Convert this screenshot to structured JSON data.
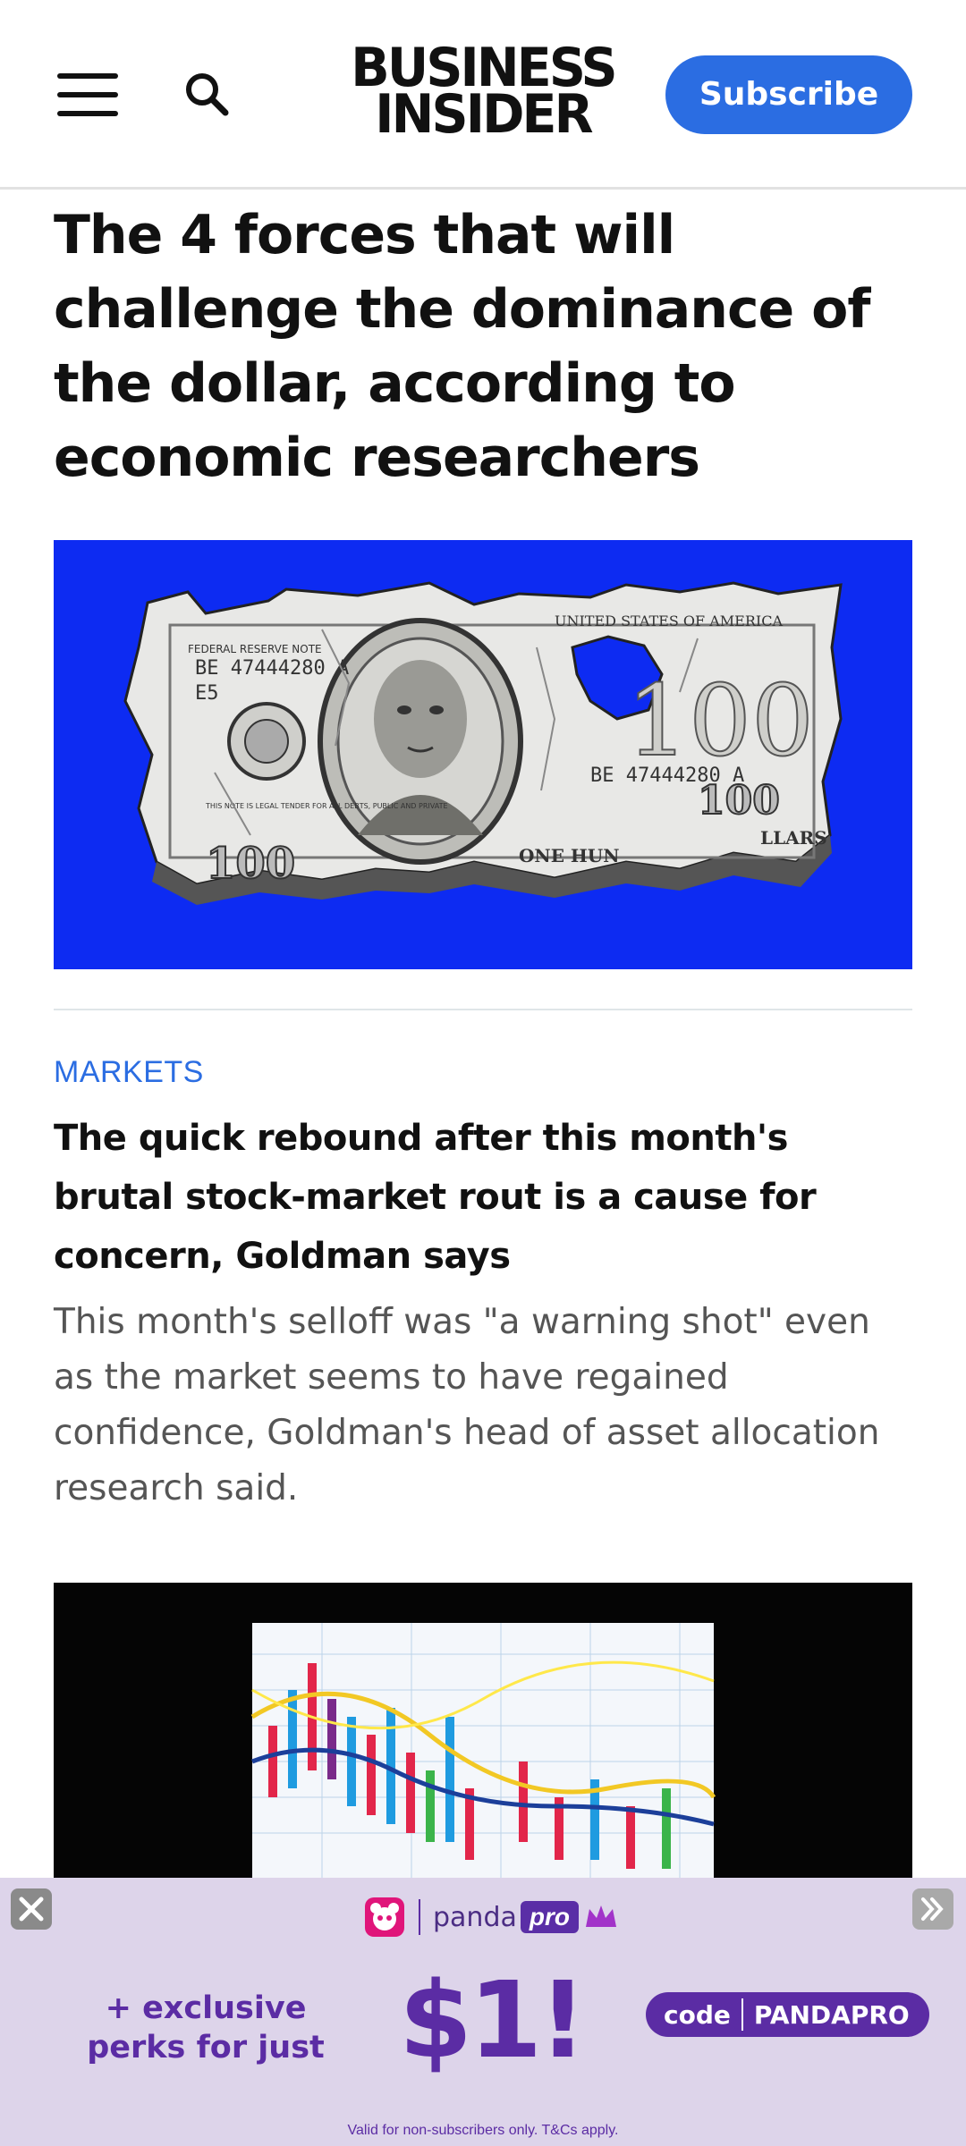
{
  "header": {
    "logo_line1": "BUSINESS",
    "logo_line2": "INSIDER",
    "subscribe_label": "Subscribe",
    "menu_icon": "hamburger-menu-icon",
    "search_icon": "search-icon"
  },
  "article": {
    "headline": "The 4 forces that will challenge the dominance of the dollar, according to economic researchers",
    "hero_alt": "torn hundred dollar bill on blue background",
    "hero_bill": {
      "serial": "BE 47444280 A",
      "serial_short": "E5",
      "denomination": "100",
      "word_100": "ONE HUN",
      "dollars_text": "LLARS",
      "federal": "FEDERAL RESERVE NOTE",
      "united_states": "UNITED STATES OF AMERICA",
      "legal_tender": "THIS NOTE IS LEGAL TENDER FOR ALL DEBTS, PUBLIC AND PRIVATE"
    }
  },
  "story": {
    "category": "MARKETS",
    "title": "The quick rebound after this month's brutal stock-market rout is a cause for concern, Goldman says",
    "description": "This month's selloff was \"a warning shot\" even as the market seems to have regained confidence, Goldman's head of asset allocation research said."
  },
  "ad": {
    "brand": "panda",
    "brand_pro": "pro",
    "perks": "+ exclusive perks for just",
    "price": "$1!",
    "code_label": "code",
    "code_value": "PANDAPRO",
    "fine_print": "Valid for non-subscribers only. T&Cs apply.",
    "close_icon": "close-icon",
    "next_icon": "double-chevron-right-icon"
  },
  "colors": {
    "accent_blue": "#2b6de2",
    "hero_blue": "#0d2bf2",
    "ad_bg": "#ddd4ea",
    "ad_purple": "#5b2ca4"
  }
}
